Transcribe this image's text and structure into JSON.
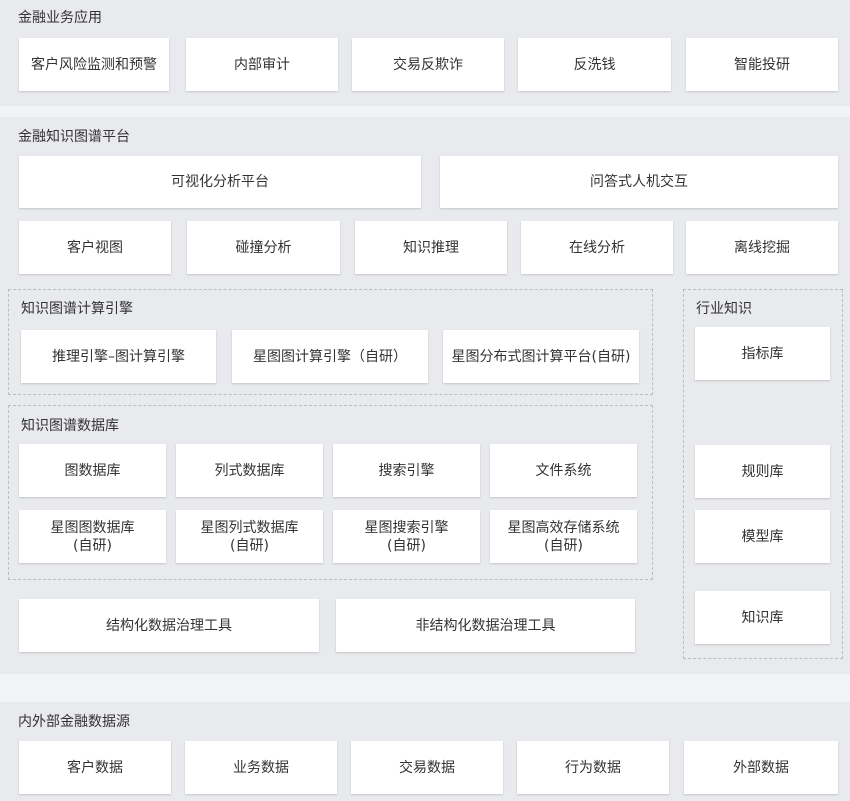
{
  "sections": {
    "applications": {
      "title": "金融业务应用",
      "items": [
        "客户风险监测和预警",
        "内部审计",
        "交易反欺诈",
        "反洗钱",
        "智能投研"
      ]
    },
    "platform": {
      "title": "金融知识图谱平台",
      "top_row": [
        "可视化分析平台",
        "问答式人机交互"
      ],
      "second_row": [
        "客户视图",
        "碰撞分析",
        "知识推理",
        "在线分析",
        "离线挖掘"
      ],
      "compute_engine": {
        "title": "知识图谱计算引擎",
        "items": [
          "推理引擎–图计算引擎",
          "星图图计算引擎（自研）",
          "星图分布式图计算平台(自研)"
        ]
      },
      "database": {
        "title": "知识图谱数据库",
        "row1": [
          "图数据库",
          "列式数据库",
          "搜索引擎",
          "文件系统"
        ],
        "row2": [
          {
            "line1": "星图图数据库",
            "line2": "(自研)"
          },
          {
            "line1": "星图列式数据库",
            "line2": "(自研)"
          },
          {
            "line1": "星图搜索引擎",
            "line2": "(自研)"
          },
          {
            "line1": "星图高效存储系统",
            "line2": "(自研)"
          }
        ]
      },
      "governance": [
        "结构化数据治理工具",
        "非结构化数据治理工具"
      ],
      "industry_knowledge": {
        "title": "行业知识",
        "items": [
          "指标库",
          "规则库",
          "模型库",
          "知识库"
        ]
      }
    },
    "data_sources": {
      "title": "内外部金融数据源",
      "items": [
        "客户数据",
        "业务数据",
        "交易数据",
        "行为数据",
        "外部数据"
      ]
    }
  }
}
